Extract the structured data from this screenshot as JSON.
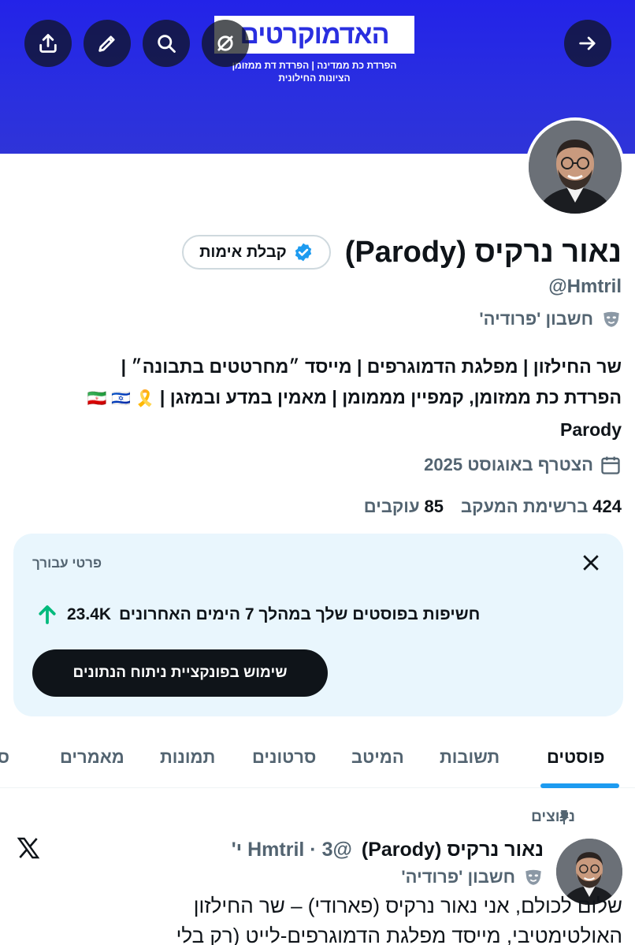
{
  "banner": {
    "logo_text": "האדמוקרטים",
    "tagline_1": "הפרדת כת ממדינה | הפרדת דת ממזומן",
    "tagline_2": "הציונות החילונית",
    "color": "#2a2fe0"
  },
  "profile": {
    "display_name": "נאור נרקיס (Parody)",
    "verify_button": "קבלת אימות",
    "handle": "@Hmtril",
    "parody_label": "חשבון 'פרודיה'",
    "bio_lines": [
      "שר החילזון | מפלגת הדמוגרפים | מייסד ״מחרטטים בתבונה״ |",
      "הפרדת כת ממזומן, קמפיין מממומן | מאמין במדע ובמזגן |",
      "Parody"
    ],
    "bio_flags": "🎗️ 🇮🇷 🇮🇱",
    "joined": "הצטרף באוגוסט 2025",
    "following_count": "424",
    "following_label": "ברשימת המעקב",
    "followers_count": "85",
    "followers_label": "עוקבים"
  },
  "pro_card": {
    "title": "פרטי עבורך",
    "stat_text": "חשיפות בפוסטים שלך במהלך 7 הימים האחרונים",
    "stat_value": "23.4K",
    "cta_label": "שימוש בפונקציית ניתוח הנתונים"
  },
  "tabs": [
    "פוסטים",
    "תשובות",
    "המיטב",
    "סרטונים",
    "תמונות",
    "מאמרים",
    "סי"
  ],
  "active_tab": "פוסטים",
  "pinned_tweet": {
    "pinned_label": "נעוצים",
    "author": "נאור נרקיס (Parody)",
    "handle_time": "@Hmtril · 3 י'",
    "parody_label": "חשבון 'פרודיה'",
    "text_lines": [
      "שלום לכולם, אני נאור נרקיס (פארודי) – שר החילזון",
      "האולטימטיבי, מייסד מפלגת הדמוגרפים-לייט (רק בלי"
    ]
  },
  "icons": [
    "share-icon",
    "edit-icon",
    "search-icon",
    "grok-icon",
    "arrow-forward-icon",
    "verified-badge-icon",
    "mask-icon",
    "calendar-icon",
    "close-icon",
    "arrow-up-icon",
    "pin-icon",
    "x-logo-icon"
  ],
  "colors": {
    "accent": "#1d9bf0",
    "text": "#0f1419",
    "secondary": "#536471",
    "card_bg": "#e9f6fd",
    "growth": "#00ba7c"
  }
}
